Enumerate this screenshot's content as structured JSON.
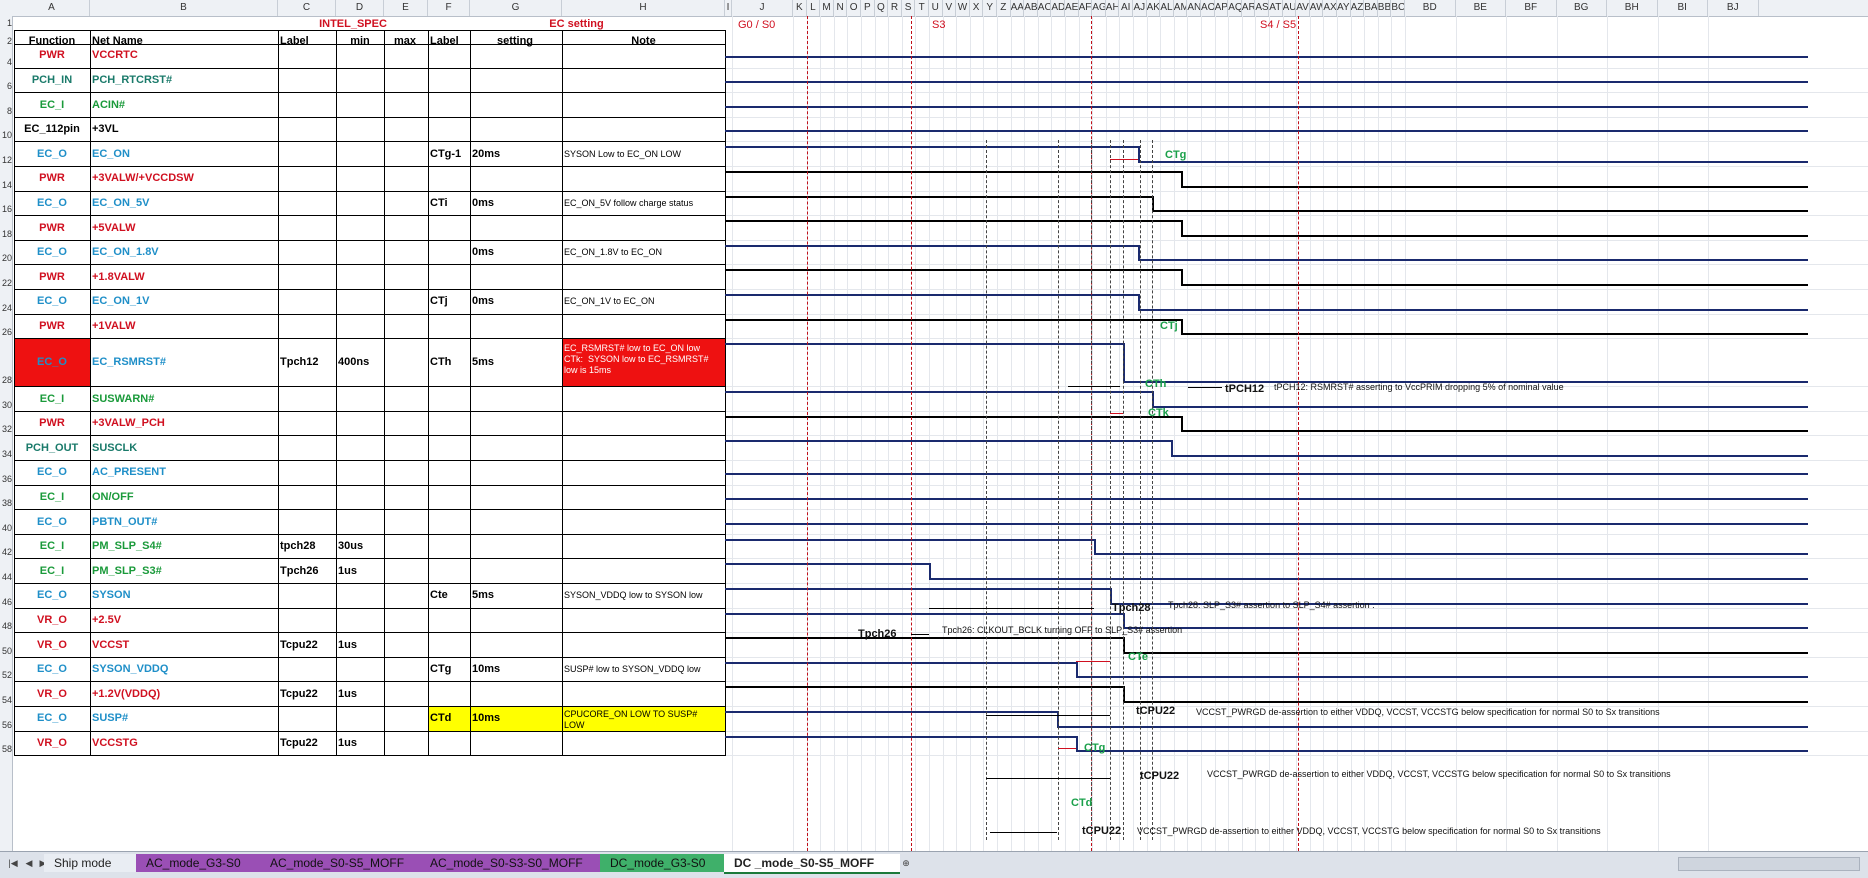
{
  "columns": [
    "A",
    "B",
    "C",
    "D",
    "E",
    "F",
    "G",
    "H",
    "I",
    "J",
    "K",
    "L",
    "M",
    "N",
    "O",
    "P",
    "Q",
    "R",
    "S",
    "T",
    "U",
    "V",
    "W",
    "X",
    "Y",
    "Z",
    "AA",
    "AB",
    "AC",
    "AD",
    "AE",
    "AF",
    "AG",
    "AH",
    "AI",
    "AJ",
    "AK",
    "AL",
    "AM",
    "AN",
    "AO",
    "AP",
    "AQ",
    "AR",
    "AS",
    "AT",
    "AU",
    "AV",
    "AW",
    "AX",
    "AY",
    "AZ",
    "BA",
    "BB",
    "BC",
    "BD",
    "BE",
    "BF",
    "BG",
    "BH",
    "BI",
    "BJ"
  ],
  "group_headers": {
    "intel_spec": "INTEL_SPEC",
    "ec_setting": "EC setting"
  },
  "headers": {
    "function": "Function",
    "net_name": "Net Name",
    "label": "Label",
    "min": "min",
    "max": "max",
    "label2": "Label",
    "setting": "setting",
    "note": "Note"
  },
  "states": {
    "g0s0": "G0 / S0",
    "s3": "S3",
    "s4s5": "S4 / S5"
  },
  "row_numbers": [
    "1",
    "2",
    "4",
    "6",
    "8",
    "10",
    "12",
    "14",
    "16",
    "18",
    "20",
    "22",
    "24",
    "26",
    "28",
    "30",
    "32",
    "34",
    "36",
    "38",
    "40",
    "42",
    "44",
    "46",
    "48",
    "50",
    "52",
    "54",
    "56",
    "58"
  ],
  "rows": [
    {
      "fn": "PWR",
      "net": "VCCRTC",
      "label": "",
      "min": "",
      "max": "",
      "ec_label": "",
      "setting": "",
      "note": ""
    },
    {
      "fn": "PCH_IN",
      "net": "PCH_RTCRST#",
      "label": "",
      "min": "",
      "max": "",
      "ec_label": "",
      "setting": "",
      "note": ""
    },
    {
      "fn": "EC_I",
      "net": "ACIN#",
      "label": "",
      "min": "",
      "max": "",
      "ec_label": "",
      "setting": "",
      "note": ""
    },
    {
      "fn": "EC_112pin",
      "net": "+3VL",
      "label": "",
      "min": "",
      "max": "",
      "ec_label": "",
      "setting": "",
      "note": ""
    },
    {
      "fn": "EC_O",
      "net": "EC_ON",
      "label": "",
      "min": "",
      "max": "",
      "ec_label": "CTg-1",
      "setting": "20ms",
      "note": "SYSON Low to EC_ON LOW"
    },
    {
      "fn": "PWR",
      "net": "+3VALW/+VCCDSW",
      "label": "",
      "min": "",
      "max": "",
      "ec_label": "",
      "setting": "",
      "note": ""
    },
    {
      "fn": "EC_O",
      "net": "EC_ON_5V",
      "label": "",
      "min": "",
      "max": "",
      "ec_label": "CTi",
      "setting": "0ms",
      "note": "EC_ON_5V follow charge status"
    },
    {
      "fn": "PWR",
      "net": "+5VALW",
      "label": "",
      "min": "",
      "max": "",
      "ec_label": "",
      "setting": "",
      "note": ""
    },
    {
      "fn": "EC_O",
      "net": "EC_ON_1.8V",
      "label": "",
      "min": "",
      "max": "",
      "ec_label": "",
      "setting": "0ms",
      "note": "EC_ON_1.8V to EC_ON"
    },
    {
      "fn": "PWR",
      "net": "+1.8VALW",
      "label": "",
      "min": "",
      "max": "",
      "ec_label": "",
      "setting": "",
      "note": ""
    },
    {
      "fn": "EC_O",
      "net": "EC_ON_1V",
      "label": "",
      "min": "",
      "max": "",
      "ec_label": "CTj",
      "setting": "0ms",
      "note": "EC_ON_1V to EC_ON"
    },
    {
      "fn": "PWR",
      "net": "+1VALW",
      "label": "",
      "min": "",
      "max": "",
      "ec_label": "",
      "setting": "",
      "note": ""
    },
    {
      "fn": "EC_O",
      "net": "EC_RSMRST#",
      "label": "Tpch12",
      "min": "400ns",
      "max": "",
      "ec_label": "CTh",
      "setting": "5ms",
      "note": "EC_RSMRST# low to EC_ON low\nCTk:  SYSON low to EC_RSMRST#\nlow is 15ms"
    },
    {
      "fn": "EC_I",
      "net": "SUSWARN#",
      "label": "",
      "min": "",
      "max": "",
      "ec_label": "",
      "setting": "",
      "note": ""
    },
    {
      "fn": "PWR",
      "net": "+3VALW_PCH",
      "label": "",
      "min": "",
      "max": "",
      "ec_label": "",
      "setting": "",
      "note": ""
    },
    {
      "fn": "PCH_OUT",
      "net": "SUSCLK",
      "label": "",
      "min": "",
      "max": "",
      "ec_label": "",
      "setting": "",
      "note": ""
    },
    {
      "fn": "EC_O",
      "net": "AC_PRESENT",
      "label": "",
      "min": "",
      "max": "",
      "ec_label": "",
      "setting": "",
      "note": ""
    },
    {
      "fn": "EC_I",
      "net": "ON/OFF",
      "label": "",
      "min": "",
      "max": "",
      "ec_label": "",
      "setting": "",
      "note": ""
    },
    {
      "fn": "EC_O",
      "net": "PBTN_OUT#",
      "label": "",
      "min": "",
      "max": "",
      "ec_label": "",
      "setting": "",
      "note": ""
    },
    {
      "fn": "EC_I",
      "net": "PM_SLP_S4#",
      "label": "tpch28",
      "min": "30us",
      "max": "",
      "ec_label": "",
      "setting": "",
      "note": ""
    },
    {
      "fn": "EC_I",
      "net": "PM_SLP_S3#",
      "label": "Tpch26",
      "min": "1us",
      "max": "",
      "ec_label": "",
      "setting": "",
      "note": ""
    },
    {
      "fn": "EC_O",
      "net": "SYSON",
      "label": "",
      "min": "",
      "max": "",
      "ec_label": "Cte",
      "setting": "5ms",
      "note": "SYSON_VDDQ low to SYSON low"
    },
    {
      "fn": "VR_O",
      "net": "+2.5V",
      "label": "",
      "min": "",
      "max": "",
      "ec_label": "",
      "setting": "",
      "note": ""
    },
    {
      "fn": "VR_O",
      "net": "VCCST",
      "label": "Tcpu22",
      "min": "1us",
      "max": "",
      "ec_label": "",
      "setting": "",
      "note": ""
    },
    {
      "fn": "EC_O",
      "net": "SYSON_VDDQ",
      "label": "",
      "min": "",
      "max": "",
      "ec_label": "CTg",
      "setting": "10ms",
      "note": "SUSP# low to SYSON_VDDQ low"
    },
    {
      "fn": "VR_O",
      "net": "+1.2V(VDDQ)",
      "label": "Tcpu22",
      "min": "1us",
      "max": "",
      "ec_label": "",
      "setting": "",
      "note": ""
    },
    {
      "fn": "EC_O",
      "net": "SUSP#",
      "label": "",
      "min": "",
      "max": "",
      "ec_label": "CTd",
      "setting": "10ms",
      "note": "CPUCORE_ON LOW TO SUSP#\nLOW"
    },
    {
      "fn": "VR_O",
      "net": "VCCSTG",
      "label": "Tcpu22",
      "min": "1us",
      "max": "",
      "ec_label": "",
      "setting": "",
      "note": ""
    }
  ],
  "annotations": {
    "ctg": "CTg",
    "ctj": "CTj",
    "cth": "CTh",
    "ctk": "CTk",
    "cte": "CTe",
    "ctg2": "CTg",
    "ctd": "CTd",
    "tpch12": "tPCH12",
    "tpch12_desc": "tPCH12:  RSMRST# asserting  to VccPRIM dropping  5% of nominal  value",
    "tpch28": "Tpch28",
    "tpch28_desc": "Tpch28:  SLP_S3# assertion  to SLP_S4# assertion  .",
    "tpch26": "Tpch26",
    "tpch26_desc": "Tpch26:  CLKOUT_BCLK  turning  OFF to SLP_S3# assertion",
    "tcpu22_1": "tCPU22",
    "tcpu22_2": "tCPU22",
    "tcpu22_3": "tCPU22",
    "tcpu22_desc1": "VCCST_PWRGD  de-assertion  to either  VDDQ, VCCST, VCCSTG  below specification  for normal  S0 to Sx transitions",
    "tcpu22_desc2": "VCCST_PWRGD  de-assertion  to either  VDDQ, VCCST, VCCSTG  below specification  for normal  S0 to Sx transitions",
    "tcpu22_desc3": "VCCST_PWRGD  de-assertion  to either  VDDQ, VCCST, VCCSTG  below specification  for normal  S0 to Sx transitions"
  },
  "tabs": [
    "Ship mode",
    "AC_mode_G3-S0",
    "AC_mode_S0-S5_MOFF",
    "AC_mode_S0-S3-S0_MOFF",
    "DC_mode_G3-S0",
    "DC _mode_S0-S5_MOFF"
  ],
  "active_tab": "DC _mode_S0-S5_MOFF",
  "colors": {
    "signal": "#1a2a6e",
    "red_text": "#d01020",
    "blue_text": "#1f8fc8",
    "green_text": "#1a9a3a",
    "highlight_red": "#ee1111",
    "highlight_yellow": "#ffff00"
  }
}
